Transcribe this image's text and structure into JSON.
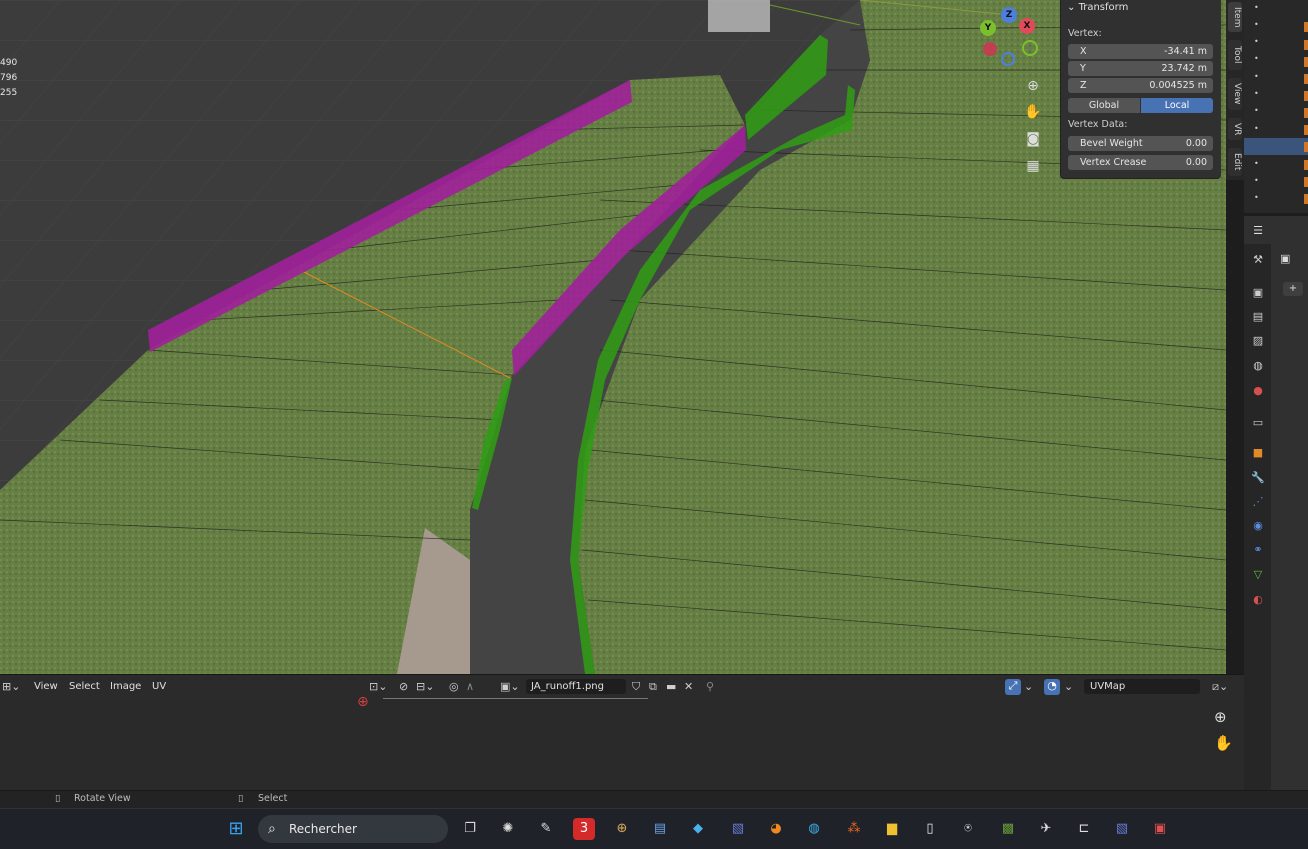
{
  "viewport": {
    "overlay_numbers": [
      "490",
      "796",
      "255"
    ]
  },
  "gizmo": {
    "z": "Z",
    "y": "Y",
    "x": "X"
  },
  "n_panel": {
    "header": "Transform",
    "vertex_label": "Vertex:",
    "x_label": "X",
    "x_value": "-34.41 m",
    "y_label": "Y",
    "y_value": "23.742 m",
    "z_label": "Z",
    "z_value": "0.004525 m",
    "global_label": "Global",
    "local_label": "Local",
    "vertex_data_label": "Vertex Data:",
    "bevel_weight_label": "Bevel Weight",
    "bevel_weight_value": "0.00",
    "vertex_crease_label": "Vertex Crease",
    "vertex_crease_value": "0.00"
  },
  "side_tabs": [
    "Item",
    "Tool",
    "View",
    "VR",
    "Edit"
  ],
  "uv_editor": {
    "menu": [
      "View",
      "Select",
      "Image",
      "UV"
    ],
    "image_name": "JA_runoff1.png",
    "uv_map": "UVMap"
  },
  "status_bar": {
    "rotate_view": "Rotate View",
    "select": "Select"
  },
  "taskbar": {
    "search_placeholder": "Rechercher"
  },
  "colors": {
    "accent_blue": "#4772b3",
    "grass": "#5d7a3c",
    "magenta": "#a0209a",
    "green_strip": "#2f9e14",
    "viewport_bg": "#3c3c3c"
  }
}
